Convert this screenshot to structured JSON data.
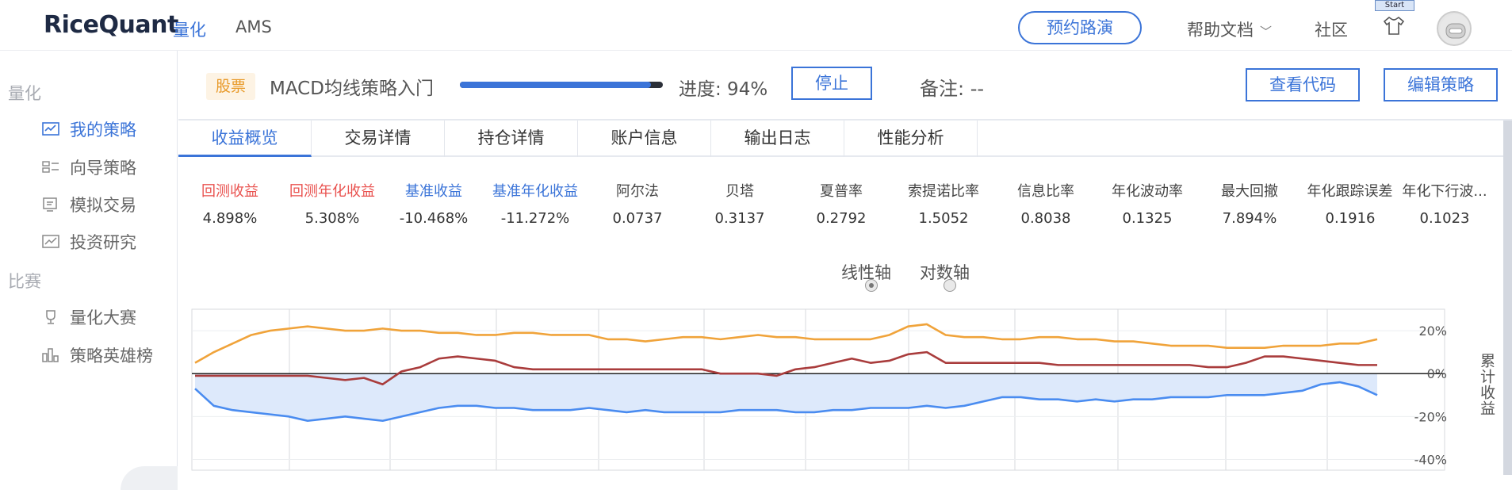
{
  "topnav": {
    "logo": "RiceQuant",
    "items": [
      "量化",
      "AMS"
    ],
    "demo_button": "预约路演",
    "help": "帮助文档",
    "community": "社区",
    "start_tag": "Start"
  },
  "sidebar": {
    "groups": [
      {
        "title": "量化",
        "items": [
          "我的策略",
          "向导策略",
          "模拟交易",
          "投资研究"
        ]
      },
      {
        "title": "比赛",
        "items": [
          "量化大赛",
          "策略英雄榜"
        ]
      }
    ]
  },
  "strategy": {
    "tag": "股票",
    "name": "MACD均线策略入门",
    "progress_percent": 94,
    "progress_text": "进度: 94%",
    "stop_button": "停止",
    "note": "备注: --",
    "view_code_button": "查看代码",
    "edit_button": "编辑策略"
  },
  "tabs": [
    "收益概览",
    "交易详情",
    "持仓详情",
    "账户信息",
    "输出日志",
    "性能分析"
  ],
  "metrics": [
    {
      "label": "回测收益",
      "value": "4.898%",
      "color": "#e9524f"
    },
    {
      "label": "回测年化收益",
      "value": "5.308%",
      "color": "#e9524f"
    },
    {
      "label": "基准收益",
      "value": "-10.468%",
      "color": "#3b74d8"
    },
    {
      "label": "基准年化收益",
      "value": "-11.272%",
      "color": "#3b74d8"
    },
    {
      "label": "阿尔法",
      "value": "0.0737"
    },
    {
      "label": "贝塔",
      "value": "0.3137"
    },
    {
      "label": "夏普率",
      "value": "0.2792"
    },
    {
      "label": "索提诺比率",
      "value": "1.5052"
    },
    {
      "label": "信息比率",
      "value": "0.8038"
    },
    {
      "label": "年化波动率",
      "value": "0.1325"
    },
    {
      "label": "最大回撤",
      "value": "7.894%"
    },
    {
      "label": "年化跟踪误差",
      "value": "0.1916"
    },
    {
      "label": "年化下行波...",
      "value": "0.1023"
    }
  ],
  "axis_switch": {
    "linear": "线性轴",
    "log": "对数轴",
    "selected": "linear"
  },
  "chart_data": {
    "type": "line",
    "ylabel": "累计收益",
    "y_ticks": [
      "20%",
      "0%",
      "-20%",
      "-40%"
    ],
    "ylim": [
      -40,
      30
    ],
    "series": [
      {
        "color": "#f0a33a",
        "values": [
          5,
          10,
          14,
          18,
          20,
          21,
          22,
          21,
          20,
          20,
          21,
          20,
          20,
          19,
          19,
          18,
          18,
          19,
          19,
          18,
          18,
          18,
          16,
          16,
          15,
          16,
          17,
          17,
          16,
          17,
          18,
          17,
          17,
          16,
          16,
          16,
          16,
          18,
          22,
          23,
          18,
          17,
          17,
          16,
          16,
          17,
          17,
          16,
          16,
          15,
          15,
          14,
          13,
          13,
          13,
          12,
          12,
          12,
          13,
          13,
          13,
          14,
          14,
          16
        ]
      },
      {
        "color": "#a93c3c",
        "values": [
          -1,
          -1,
          -1,
          -1,
          -1,
          -1,
          -1,
          -2,
          -3,
          -2,
          -5,
          1,
          3,
          7,
          8,
          7,
          6,
          3,
          2,
          2,
          2,
          2,
          2,
          2,
          2,
          2,
          2,
          2,
          0,
          0,
          0,
          -1,
          2,
          3,
          5,
          7,
          5,
          6,
          9,
          10,
          5,
          5,
          5,
          5,
          5,
          5,
          4,
          4,
          4,
          4,
          4,
          4,
          4,
          4,
          3,
          3,
          5,
          8,
          8,
          7,
          6,
          5,
          4,
          4
        ]
      },
      {
        "color": "#4a8cf0",
        "fill": "#dde9fb",
        "values": [
          -7,
          -15,
          -17,
          -18,
          -19,
          -20,
          -22,
          -21,
          -20,
          -21,
          -22,
          -20,
          -18,
          -16,
          -15,
          -15,
          -16,
          -16,
          -17,
          -17,
          -17,
          -16,
          -17,
          -18,
          -17,
          -18,
          -18,
          -18,
          -18,
          -17,
          -17,
          -17,
          -18,
          -18,
          -17,
          -17,
          -16,
          -16,
          -16,
          -15,
          -16,
          -15,
          -13,
          -11,
          -11,
          -12,
          -12,
          -13,
          -12,
          -13,
          -12,
          -12,
          -11,
          -11,
          -11,
          -10,
          -10,
          -10,
          -9,
          -8,
          -5,
          -4,
          -6,
          -10
        ]
      }
    ]
  }
}
